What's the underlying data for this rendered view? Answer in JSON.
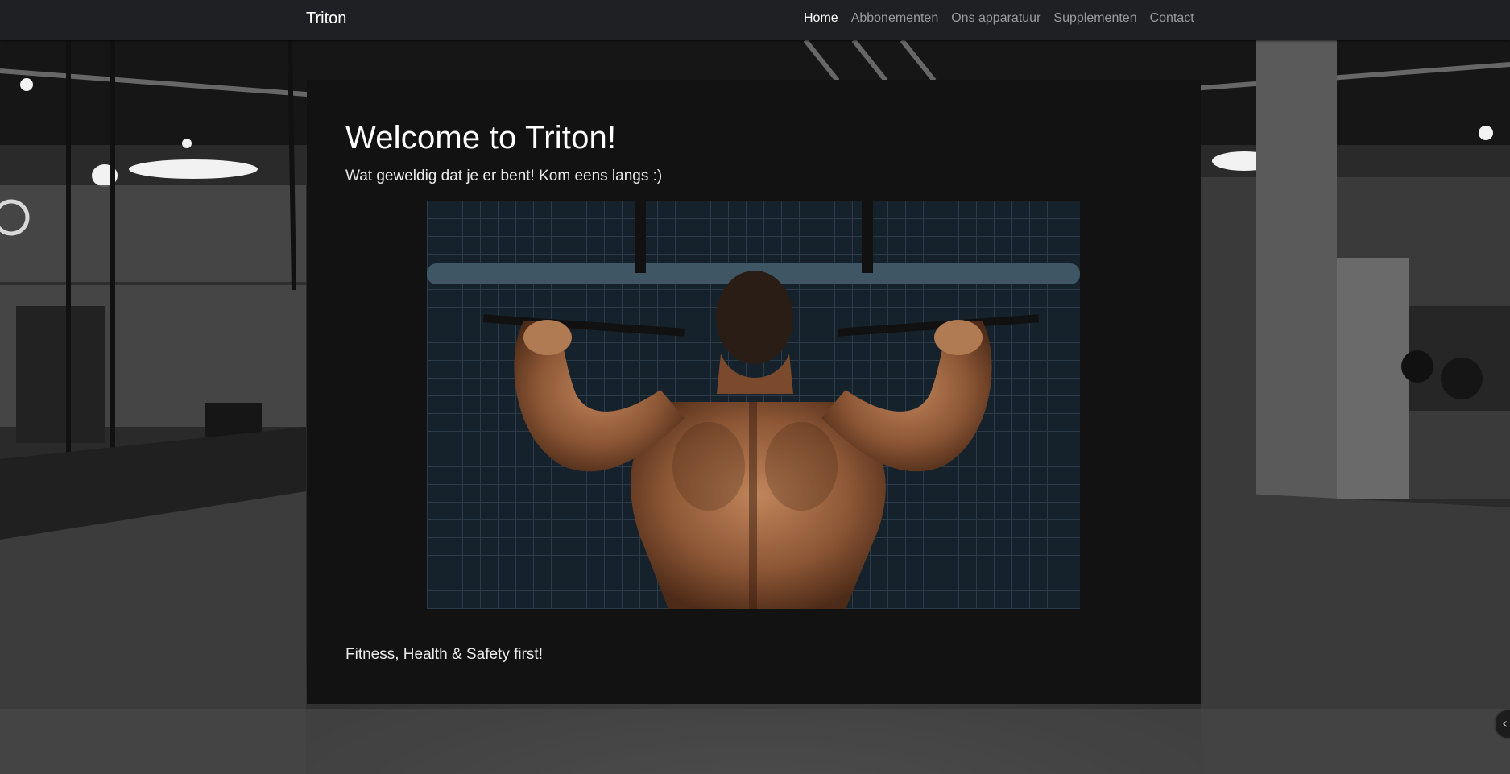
{
  "navbar": {
    "brand": "Triton",
    "links": [
      {
        "label": "Home",
        "active": true
      },
      {
        "label": "Abbonementen",
        "active": false
      },
      {
        "label": "Ons apparatuur",
        "active": false
      },
      {
        "label": "Supplementen",
        "active": false
      },
      {
        "label": "Contact",
        "active": false
      }
    ]
  },
  "main": {
    "title": "Welcome to Triton!",
    "subtitle": "Wat geweldig dat je er bent! Kom eens langs :)",
    "hero_image": "man-doing-pull-ups-photo",
    "footer_text": "Fitness, Health & Safety first!"
  },
  "background_image": "gym-interior-photo",
  "side_button": {
    "icon": "chevron-left-icon"
  },
  "colors": {
    "navbar_bg": "#1f2023",
    "card_bg": "#121212",
    "active_link": "#ffffff",
    "inactive_link": "#9a9b9e"
  }
}
